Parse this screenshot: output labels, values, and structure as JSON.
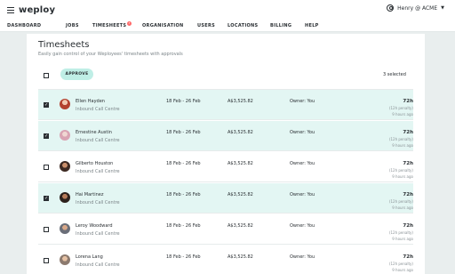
{
  "app": {
    "logo": "weploy"
  },
  "user": {
    "label": "Henry @ ACME",
    "icon": "user-icon"
  },
  "nav": {
    "items": [
      "DASHBOARD",
      "JOBS",
      "TIMESHEETS",
      "ORGANISATION",
      "USERS",
      "LOCATIONS",
      "BILLING",
      "HELP"
    ],
    "badge": "!"
  },
  "page": {
    "title": "Timesheets",
    "subtitle": "Easily gain control of your Weployees' timesheets with approvals",
    "approve_label": "APPROVE",
    "selected_text": "3 selected"
  },
  "rows": [
    {
      "name": "Ellen Hayden",
      "team": "Inbound Call Centre",
      "dates": "18 Feb - 26 Feb",
      "amount": "A$3,525.82",
      "owner": "Owner: You",
      "hours": "72h",
      "penalty": "(12h penalty)",
      "ago": "9 hours ago",
      "selected": true
    },
    {
      "name": "Ernestine Austin",
      "team": "Inbound Call Centre",
      "dates": "18 Feb - 26 Feb",
      "amount": "A$3,525.82",
      "owner": "Owner: You",
      "hours": "72h",
      "penalty": "(12h penalty)",
      "ago": "9 hours ago",
      "selected": true
    },
    {
      "name": "Gilberto Houston",
      "team": "Inbound Call Centre",
      "dates": "18 Feb - 26 Feb",
      "amount": "A$3,525.82",
      "owner": "Owner: You",
      "hours": "72h",
      "penalty": "(12h penalty)",
      "ago": "9 hours ago",
      "selected": false
    },
    {
      "name": "Hai Martinez",
      "team": "Inbound Call Centre",
      "dates": "18 Feb - 26 Feb",
      "amount": "A$3,525.82",
      "owner": "Owner: You",
      "hours": "72h",
      "penalty": "(12h penalty)",
      "ago": "9 hours ago",
      "selected": true
    },
    {
      "name": "Leroy Woodward",
      "team": "Inbound Call Centre",
      "dates": "18 Feb - 26 Feb",
      "amount": "A$3,525.82",
      "owner": "Owner: You",
      "hours": "72h",
      "penalty": "(12h penalty)",
      "ago": "9 hours ago",
      "selected": false
    },
    {
      "name": "Lorena Lang",
      "team": "Inbound Call Centre",
      "dates": "18 Feb - 26 Feb",
      "amount": "A$3,525.82",
      "owner": "Owner: You",
      "hours": "72h",
      "penalty": "(12h penalty)",
      "ago": "9 hours ago",
      "selected": false
    }
  ],
  "colors": {
    "accent": "#bfeee6",
    "selected_row": "#e3f6f3",
    "badge": "#ff6b6b"
  }
}
